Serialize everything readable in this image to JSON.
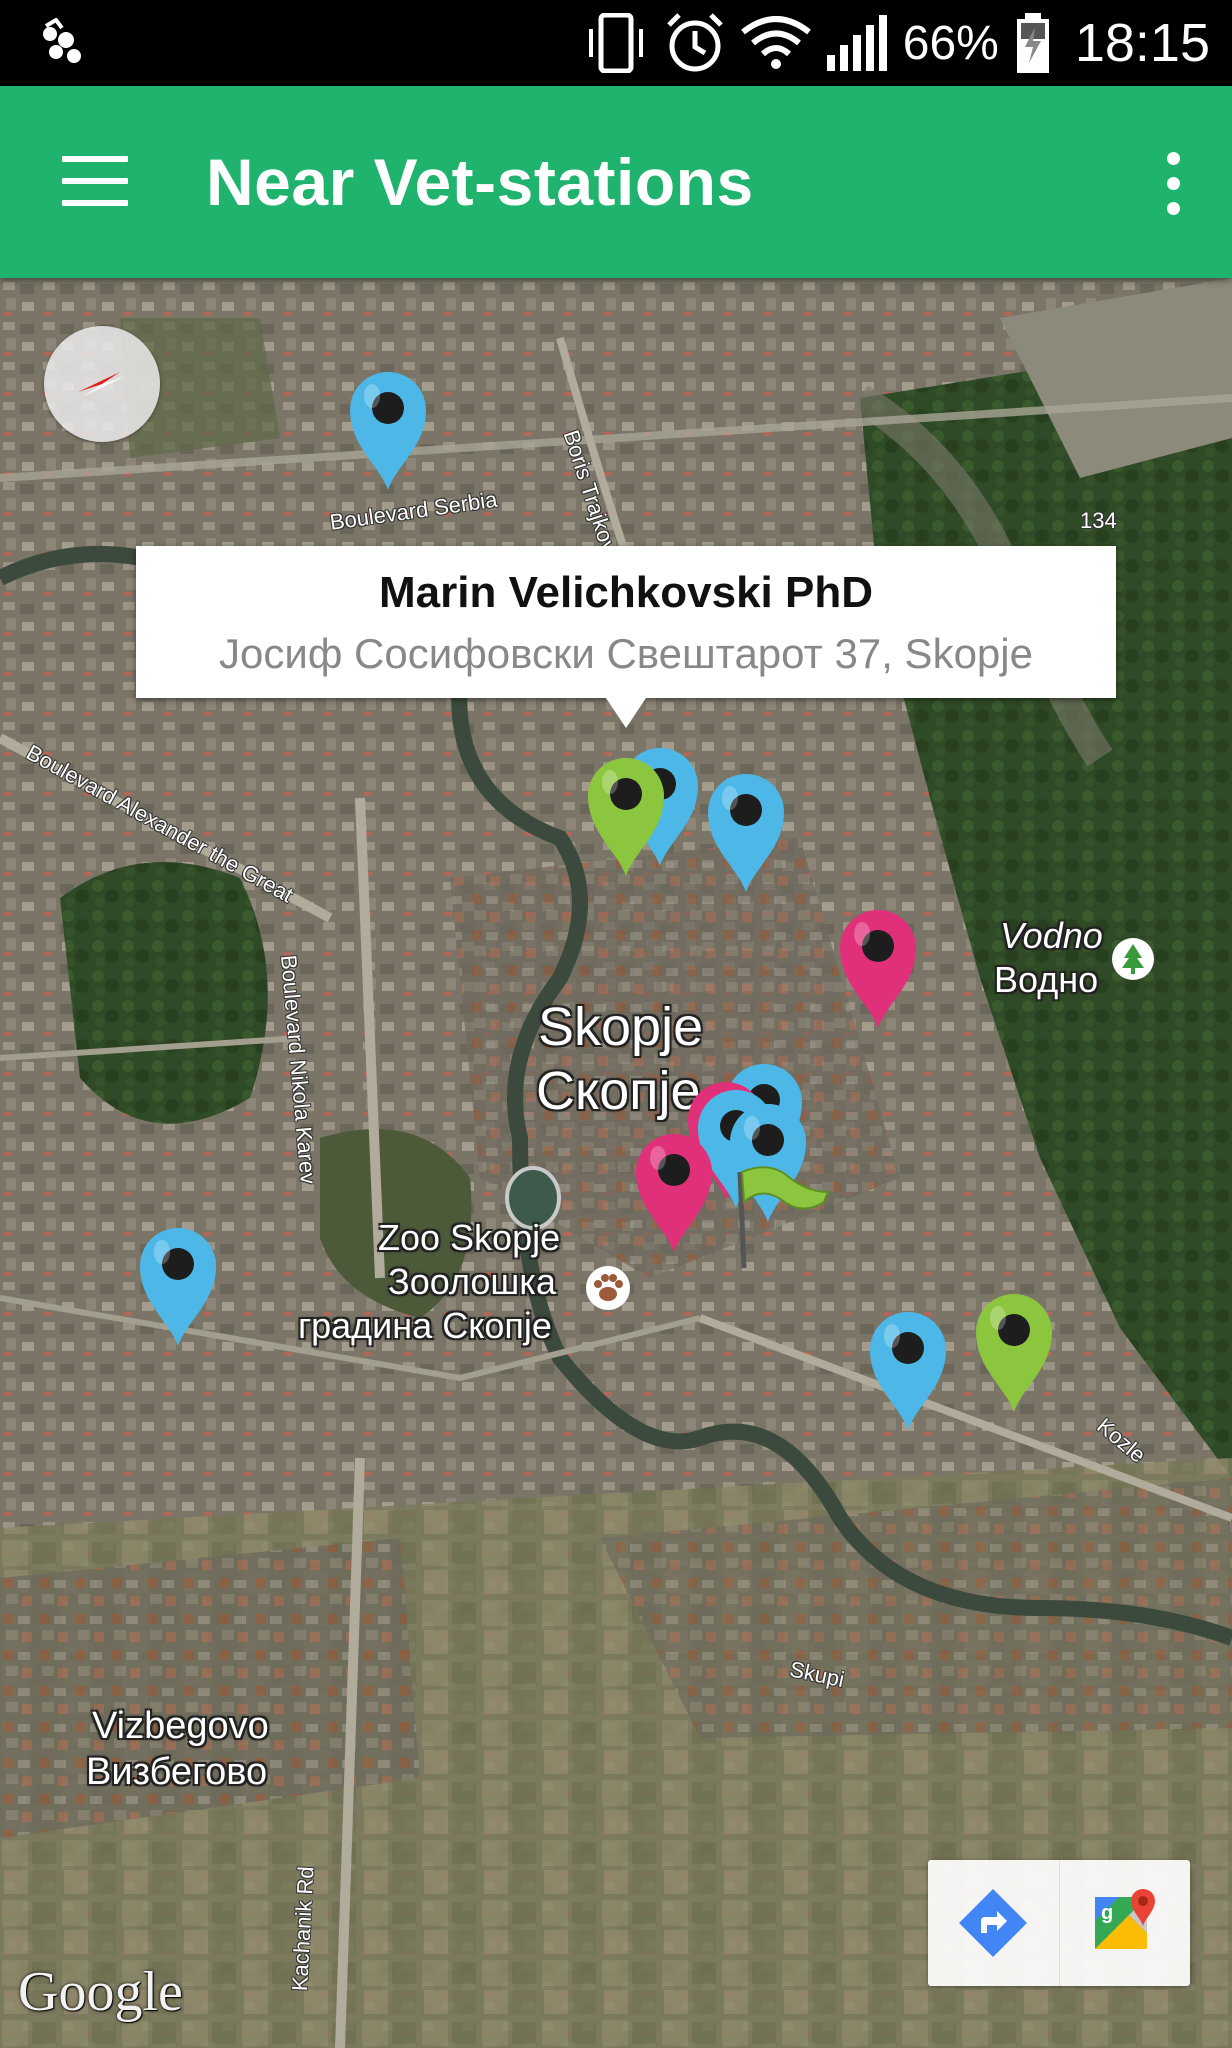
{
  "status_bar": {
    "battery": "66%",
    "time": "18:15",
    "icons": [
      "app-notification-icon",
      "vibrate-icon",
      "alarm-icon",
      "wifi-icon",
      "signal-icon",
      "battery-icon"
    ]
  },
  "app_bar": {
    "title": "Near Vet-stations",
    "icons": [
      "menu-icon",
      "overflow-menu-icon"
    ]
  },
  "info_window": {
    "title": "Marin Velichkovski PhD",
    "address": "Јосиф Сосифовски Свештарот 37, Skopje"
  },
  "map": {
    "labels": {
      "skopje_latin": "Skopje",
      "skopje_cyrillic": "Скопје",
      "zoo_latin": "Zoo Skopje",
      "zoo_cyrillic_1": "Зоолошка",
      "zoo_cyrillic_2": "градина Скопје",
      "vodno_latin": "Vodno",
      "vodno_cyrillic": "Водно",
      "vizbegovo_latin": "Vizbegovo",
      "vizbegovo_cyrillic": "Визбегово"
    },
    "roads": {
      "boulevard_serbia": "Boulevard Serbia",
      "boris_trajkovski": "Boris Trajkovski",
      "alexander_the_great": "Boulevard Alexander the Great",
      "nikola_karev": "Boulevard Nikola Karev",
      "kozle": "Kozle",
      "skupi": "Skupi",
      "kachanik": "Kachanik Rd",
      "route_134": "134"
    },
    "marker_colors": {
      "blue": "#4db8e8",
      "green": "#8cc63f",
      "pink": "#e0307a"
    },
    "markers": [
      {
        "color": "blue"
      },
      {
        "color": "blue"
      },
      {
        "color": "green"
      },
      {
        "color": "blue"
      },
      {
        "color": "pink"
      },
      {
        "color": "blue"
      },
      {
        "color": "blue"
      },
      {
        "color": "pink"
      },
      {
        "color": "blue"
      },
      {
        "color": "blue"
      },
      {
        "color": "blue"
      },
      {
        "color": "green"
      }
    ],
    "attribution": "Google",
    "toolbar_icons": [
      "directions-icon",
      "google-maps-icon"
    ]
  }
}
